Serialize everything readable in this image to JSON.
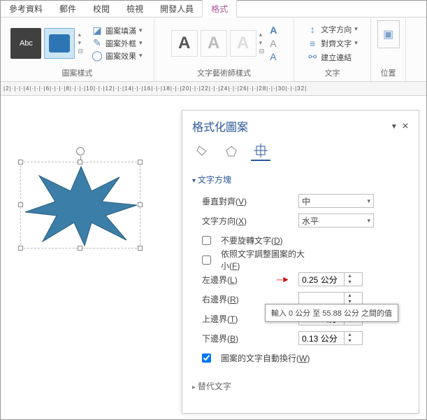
{
  "tabs": {
    "references": "參考資料",
    "mailings": "郵件",
    "review": "校閱",
    "view": "檢視",
    "developer": "開發人員",
    "format": "格式"
  },
  "ribbon": {
    "shape_styles_label": "圖案樣式",
    "abc": "Abc",
    "fill": "圖案填滿",
    "outline": "圖案外框",
    "effects": "圖案效果",
    "wordart_label": "文字藝術師樣式",
    "text_direction": "文字方向",
    "align_text": "對齊文字",
    "create_link": "建立連結",
    "text_group_label": "文字",
    "position": "位置"
  },
  "ruler": "|2|·|·|·|4|·|·|·|6|·|·|·|8|·|·|·|10|·|·|12|·|·|14|·|·|16|·|·|18|·|·|20|·|·|22|·|·|24|·|·|26|·|·|28|·|·|30|·|·|32|",
  "pane": {
    "title": "格式化圖案",
    "section_textbox": "文字方塊",
    "valign_label": "垂直對齊(",
    "valign_key": "V",
    "valign_value": "中",
    "tdir_label": "文字方向(",
    "tdir_key": "X",
    "tdir_value": "水平",
    "no_rotate_label": "不要旋轉文字(",
    "no_rotate_key": "D",
    "resize_label": "依照文字調整圖案的大小(",
    "resize_key": "F",
    "left_label": "左邊界(",
    "left_key": "L",
    "left_value": "0.25 公分",
    "right_label": "右邊界(",
    "right_key": "R",
    "right_value": "",
    "top_label": "上邊界(",
    "top_key": "T",
    "top_value": "0.13 公分",
    "bottom_label": "下邊界(",
    "bottom_key": "B",
    "bottom_value": "0.13 公分",
    "wrap_label": "圖案的文字自動換行(",
    "wrap_key": "W",
    "alt_text": "替代文字",
    "close_paren": ")"
  },
  "tooltip": "輸入 0 公分 至 55.88 公分 之間的值"
}
